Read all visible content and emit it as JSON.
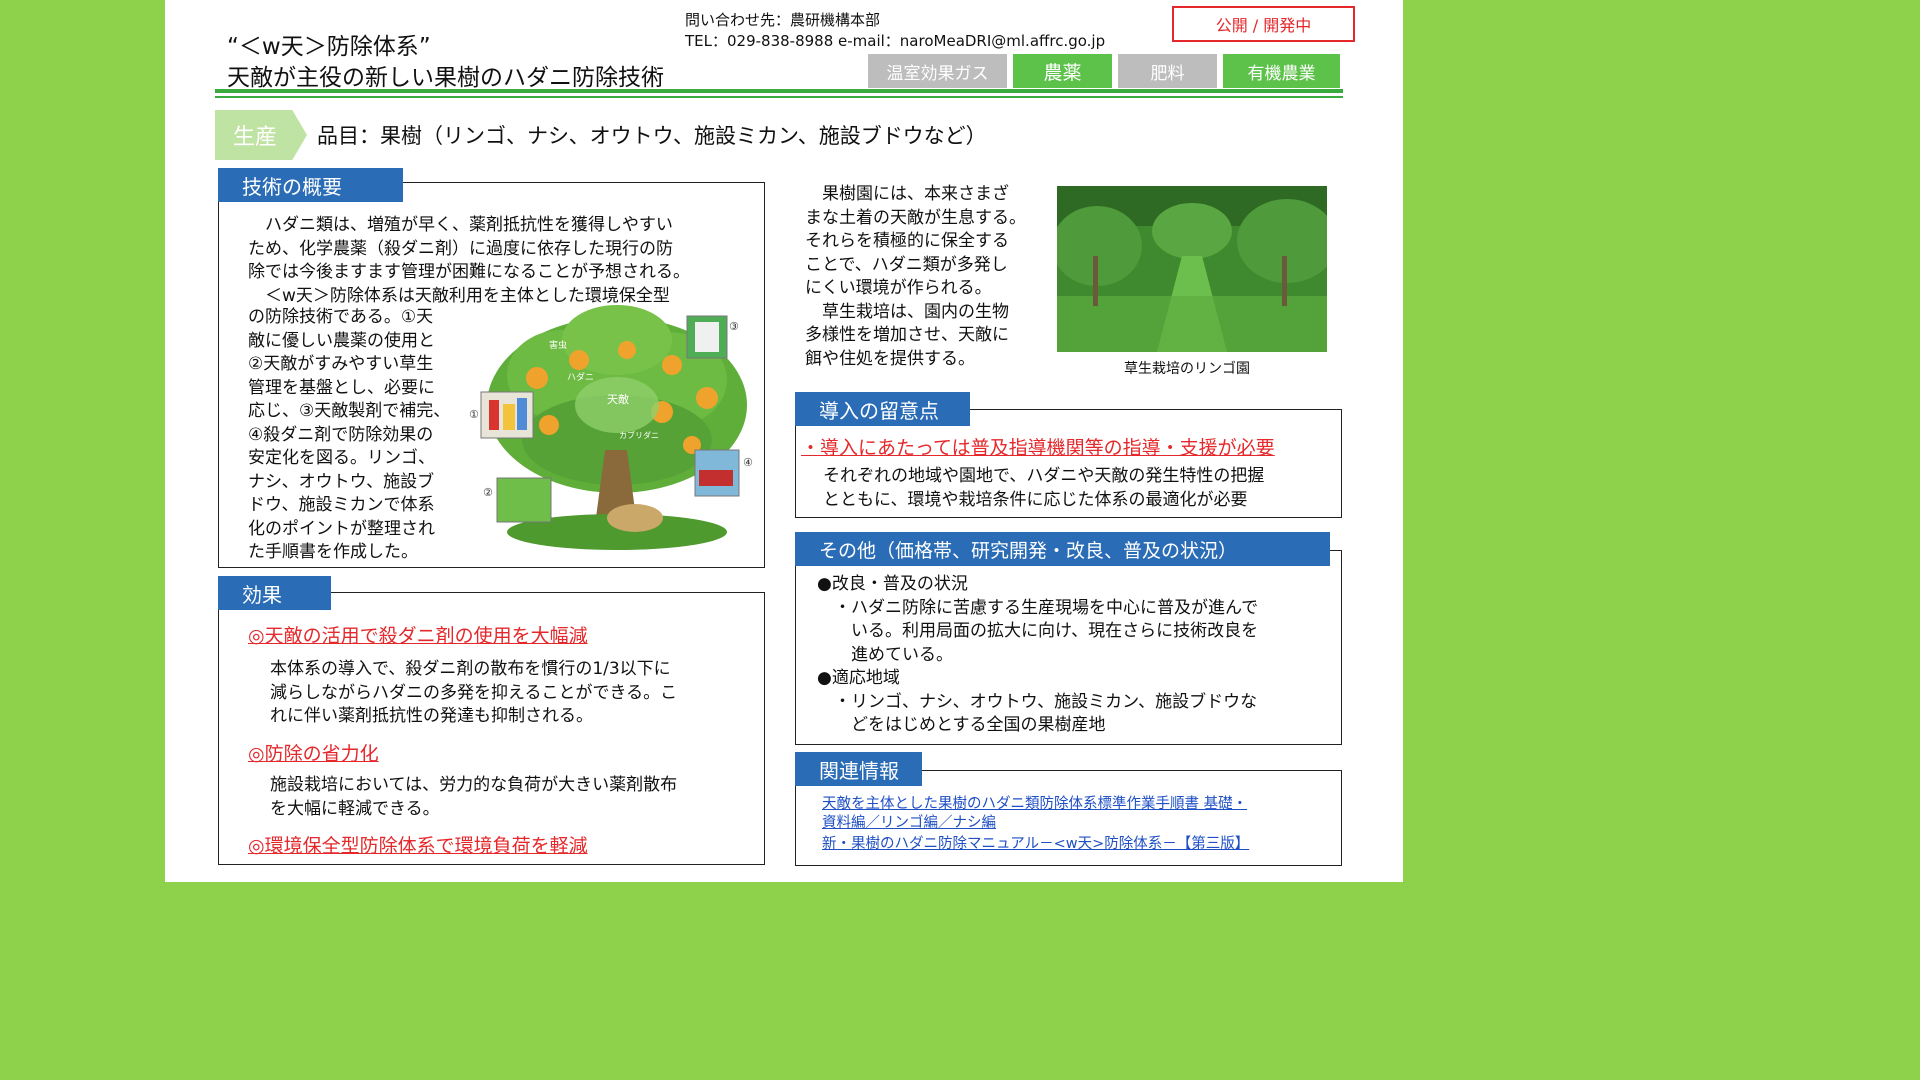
{
  "header": {
    "title_line1": "“＜w天＞防除体系”",
    "title_line2": "天敵が主役の新しい果樹のハダニ防除技術",
    "contact_line1": "問い合わせ先：農研機構本部",
    "contact_line2": "TEL：029-838-8988 e-mail：naroMeaDRI@ml.affrc.go.jp",
    "status": "公開 / 開発中",
    "tags": [
      "温室効果ガス",
      "農薬",
      "肥料",
      "有機農業"
    ]
  },
  "category": {
    "label": "生産",
    "item": "品目：果樹（リンゴ、ナシ、オウトウ、施設ミカン、施設ブドウなど）"
  },
  "overview": {
    "heading": "技術の概要",
    "para1": [
      "ハダニ類は、増殖が早く、薬剤抵抗性を獲得しやすい",
      "ため、化学農薬（殺ダニ剤）に過度に依存した現行の防",
      "除では今後ますます管理が困難になることが予想される。",
      "＜w天＞防除体系は天敵利用を主体とした環境保全型"
    ],
    "para2": [
      "の防除技術である。①天",
      "敵に優しい農薬の使用と",
      "②天敵がすみやすい草生",
      "管理を基盤とし、必要に",
      "応じ、③天敵製剤で補完、",
      "④殺ダニ剤で防除効果の",
      "安定化を図る。リンゴ、",
      "ナシ、オウトウ、施設ブ",
      "ドウ、施設ミカンで体系",
      "化のポイントが整理され",
      "た手順書を作成した。"
    ],
    "fig_labels": {
      "tree_label": "天敵",
      "small_a": "害虫",
      "small_b": "ハダニ",
      "small_c": "カブリダニ",
      "n1": "①",
      "n2": "②",
      "n3": "③",
      "n4": "④"
    }
  },
  "orchard": {
    "text": [
      "果樹園には、本来さまざ",
      "まな土着の天敵が生息する。",
      "それらを積極的に保全する",
      "ことで、ハダニ類が多発し",
      "にくい環境が作られる。",
      "草生栽培は、園内の生物",
      "多様性を増加させ、天敵に",
      "餌や住処を提供する。"
    ],
    "caption": "草生栽培のリンゴ園"
  },
  "effects": {
    "heading": "効果",
    "h1": "◎天敵の活用で殺ダニ剤の使用を大幅減",
    "p1": [
      "本体系の導入で、殺ダニ剤の散布を慣行の1/3以下に",
      "減らしながらハダニの多発を抑えることができる。こ",
      "れに伴い薬剤抵抗性の発達も抑制される。"
    ],
    "h2": "◎防除の省力化",
    "p2": [
      "施設栽培においては、労力的な負荷が大きい薬剤散布",
      "を大幅に軽減できる。"
    ],
    "h3": "◎環境保全型防除体系で環境負荷を軽減"
  },
  "notes": {
    "heading": "導入の留意点",
    "h1": "・導入にあたっては普及指導機関等の指導・支援が必要",
    "p1": [
      "それぞれの地域や園地で、ハダニや天敵の発生特性の把握",
      "とともに、環境や栽培条件に応じた体系の最適化が必要"
    ]
  },
  "other": {
    "heading": "その他（価格帯、研究開発・改良、普及の状況）",
    "b1": "●改良・普及の状況",
    "b1_text": [
      "・ハダニ防除に苦慮する生産現場を中心に普及が進んで",
      "いる。利用局面の拡大に向け、現在さらに技術改良を",
      "進めている。"
    ],
    "b2": "●適応地域",
    "b2_text": [
      "・リンゴ、ナシ、オウトウ、施設ミカン、施設ブドウな",
      "どをはじめとする全国の果樹産地"
    ]
  },
  "related": {
    "heading": "関連情報",
    "link1": [
      "天敵を主体とした果樹のハダニ類防除体系標準作業手順書 基礎・",
      "資料編／リンゴ編／ナシ編"
    ],
    "link2": "新・果樹のハダニ防除マニュアル－<w天>防除体系－【第三版】"
  },
  "colors": {
    "page_bg": "#8ed14b",
    "accent_green": "#3aab3e",
    "header_blue": "#2a6cb5",
    "alert_red": "#e4282b"
  }
}
